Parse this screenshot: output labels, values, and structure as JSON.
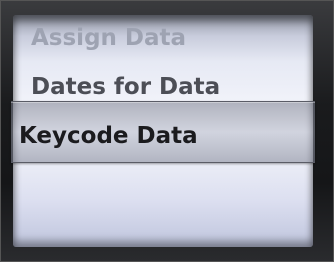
{
  "picker": {
    "options": [
      {
        "label": "Assign Data"
      },
      {
        "label": "Dates for Data"
      },
      {
        "label": "Keycode Data"
      }
    ],
    "selected_index": 2
  }
}
